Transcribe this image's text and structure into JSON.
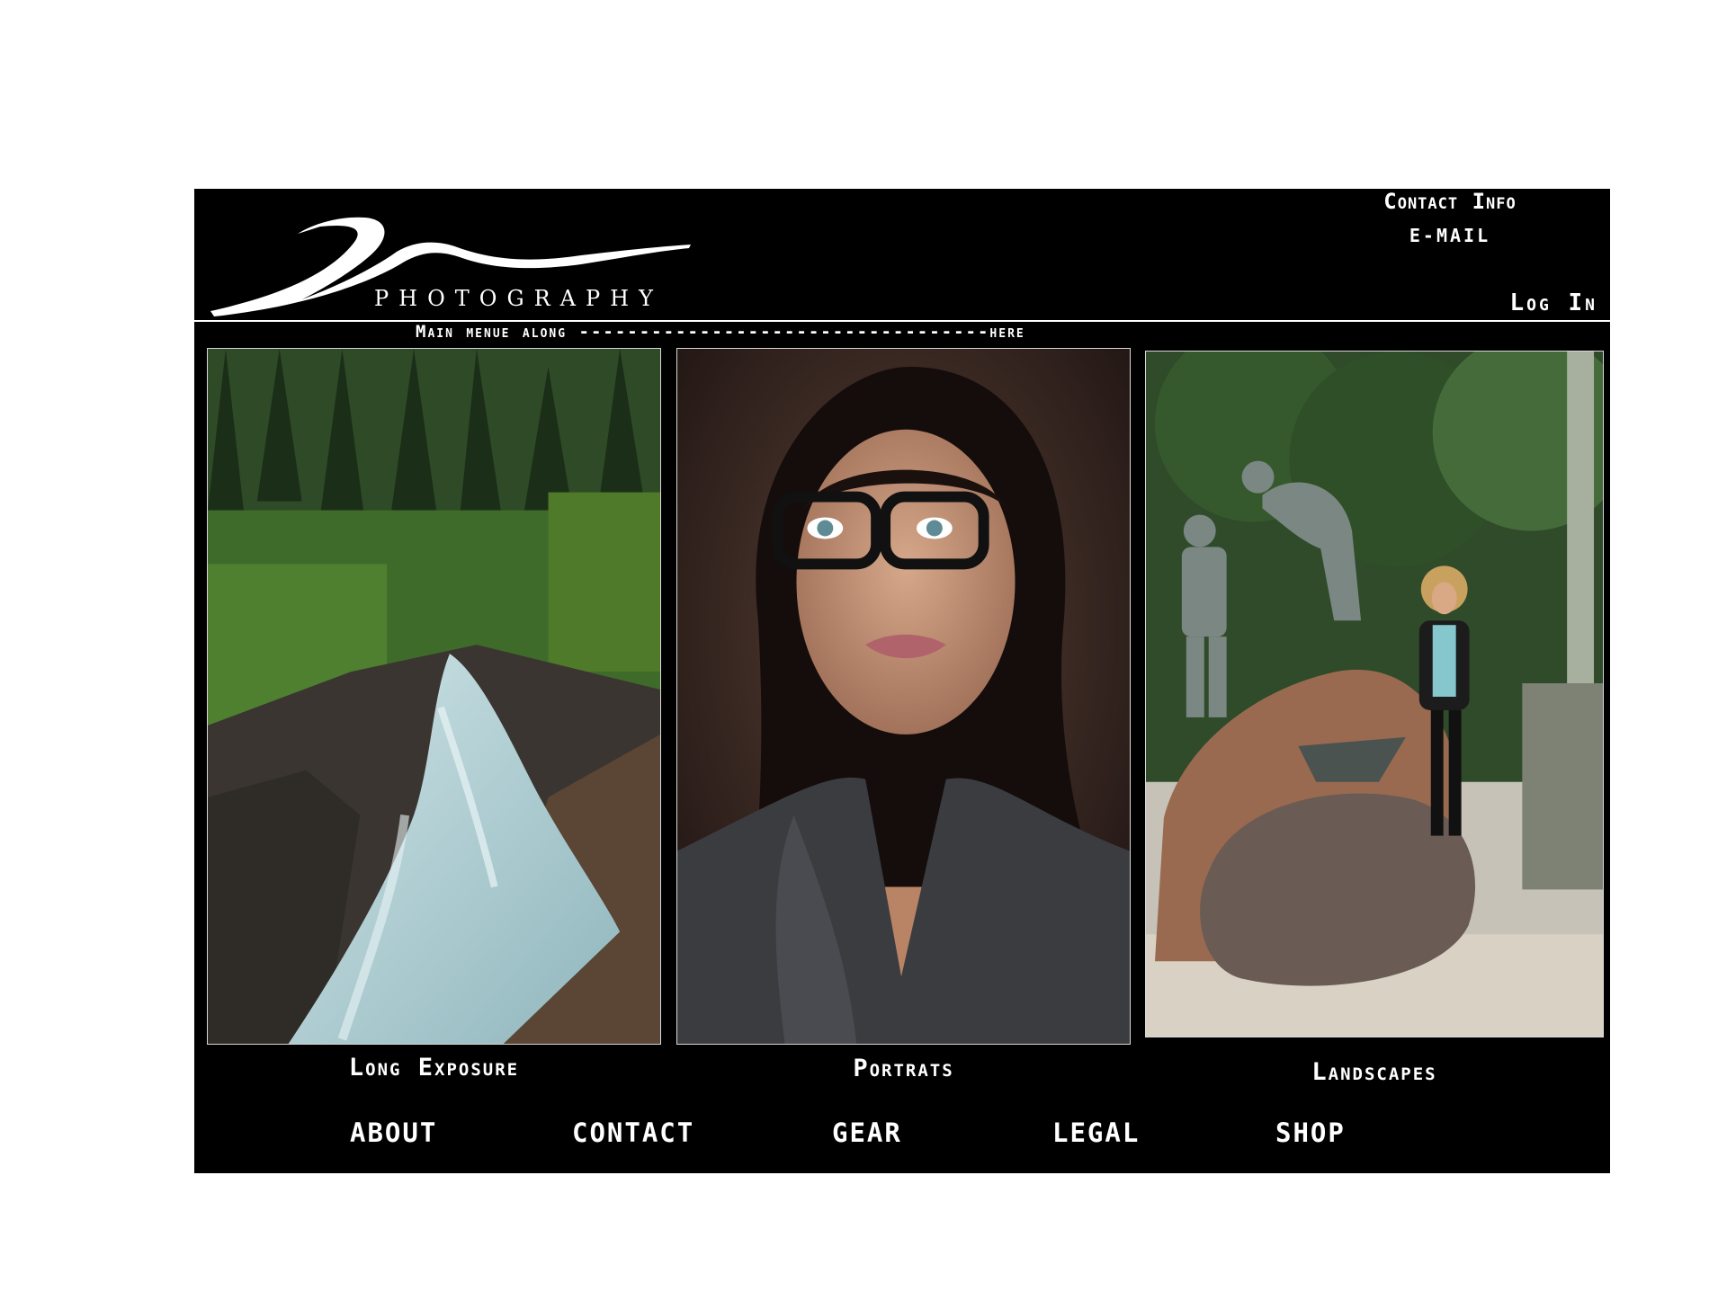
{
  "header": {
    "logo_text": "PHOTOGRAPHY",
    "contact_info": "Contact Info",
    "email": "E-MAIL",
    "login": "Log In"
  },
  "menu": {
    "placeholder": "Main menue along  ----------------------------------here"
  },
  "gallery": [
    {
      "caption": "Long Exposure",
      "image": "waterfall-forest"
    },
    {
      "caption": "Portrats",
      "image": "woman-with-glasses"
    },
    {
      "caption": "Landscapes",
      "image": "statue-with-woman"
    }
  ],
  "footer_nav": [
    "ABOUT",
    "CONTACT",
    "GEAR",
    "LEGAL",
    "SHOP"
  ],
  "colors": {
    "background": "#000000",
    "text": "#ffffff",
    "page": "#ffffff"
  }
}
